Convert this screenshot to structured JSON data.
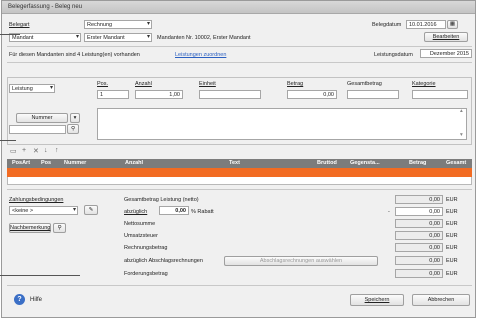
{
  "window": {
    "title": "Belegerfassung - Beleg neu"
  },
  "header": {
    "belegart_label": "Belegart",
    "belegart_value": "Rechnung",
    "belegdatum_label": "Belegdatum",
    "belegdatum_value": "10.01.2016",
    "mandant_type": "Mandant",
    "mandant_value": "Erster Mandant",
    "mandant_info": "Mandanten Nr. 10002, Erster Mandant",
    "bearbeiten_label": "Bearbeiten",
    "leistungen_info": "Für diesen Mandanten sind 4 Leistung(en) vorhanden",
    "leistungen_link": "Leistungen zuordnen",
    "leistungsdatum_label": "Leistungsdatum",
    "leistungsdatum_value": "Dezember 2015"
  },
  "position": {
    "type_value": "Leistung",
    "pos_label": "Pos.",
    "pos_value": "1",
    "anzahl_label": "Anzahl",
    "anzahl_value": "1,00",
    "einheit_label": "Einheit",
    "betrag_label": "Betrag",
    "betrag_value": "0,00",
    "gesamtbetrag_label": "Gesamtbetrag",
    "kategorie_label": "Kategorie",
    "nummer_label": "Nummer"
  },
  "grid": {
    "columns": [
      "PosArt",
      "Pos",
      "Nummer",
      "Anzahl",
      "Text",
      "Bruttod",
      "Gegensta...",
      "Betrag",
      "Gesamt"
    ]
  },
  "footer": {
    "zahlungsbedingungen_label": "Zahlungsbedingungen",
    "zahlungsbedingungen_value": "<keine >",
    "nachbemerkung_label": "Nachbemerkung",
    "gesamtbetrag_label": "Gesamtbetrag Leistung (netto)",
    "abzueglich_label": "abzüglich",
    "rabatt_value": "0,00",
    "rabatt_unit": "% Rabatt",
    "nettosumme_label": "Nettosumme",
    "umsatzsteuer_label": "Umsatzsteuer",
    "rechnungsbetrag_label": "Rechnungsbetrag",
    "abschlag_label": "abzüglich Abschlagsrechnungen",
    "abschlag_button": "Abschlagsrechnungen auswählen",
    "forderungsbetrag_label": "Forderungsbetrag",
    "minus_sign": "-",
    "amounts": [
      "0,00",
      "0,00",
      "0,00",
      "0,00",
      "0,00",
      "0,00",
      "0,00"
    ],
    "currency": "EUR"
  },
  "bottom": {
    "hilfe_label": "Hilfe",
    "speichern_label": "Speichern",
    "abbrechen_label": "Abbrechen"
  },
  "colors": {
    "grid_header": "#7c7c7c",
    "selected_row": "#f26b22",
    "help_icon": "#3b6fc6"
  },
  "icons": [
    "calendar-icon",
    "search-icon",
    "add-icon",
    "delete-icon",
    "move-down-icon",
    "move-up-icon",
    "new-row-icon",
    "help-icon",
    "edit-icon",
    "search-small-icon"
  ]
}
